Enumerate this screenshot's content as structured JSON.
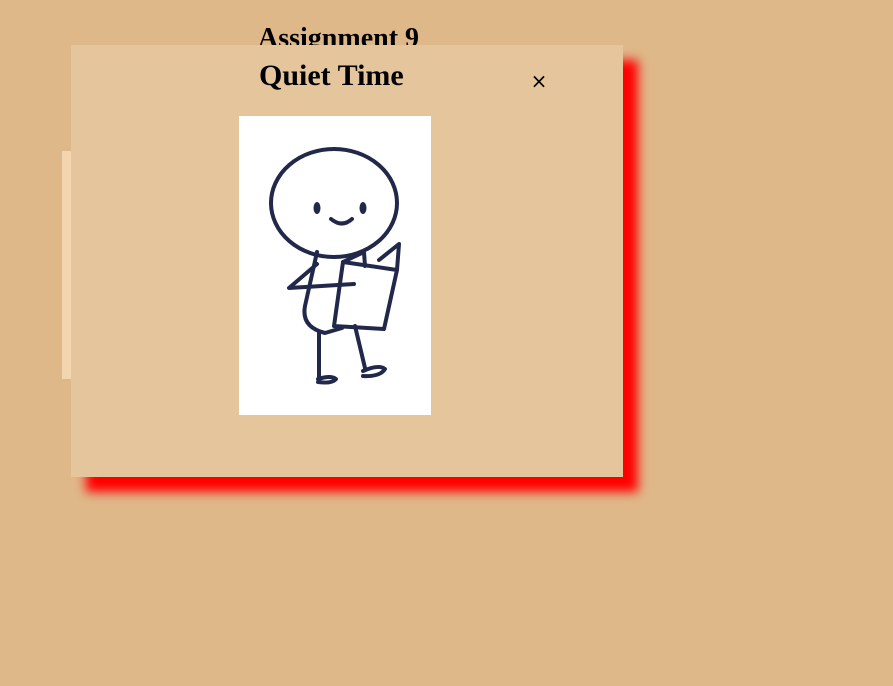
{
  "page": {
    "heading": "Assignment 9"
  },
  "modal": {
    "title": "Quiet Time",
    "close_label": "×",
    "illustration": {
      "icon": "stick-figure-reading-book-icon"
    }
  },
  "colors": {
    "page_background": "#dfb889",
    "modal_background": "#e5c69c",
    "modal_shadow": "#ff0000",
    "illustration_stroke": "#22284a"
  }
}
